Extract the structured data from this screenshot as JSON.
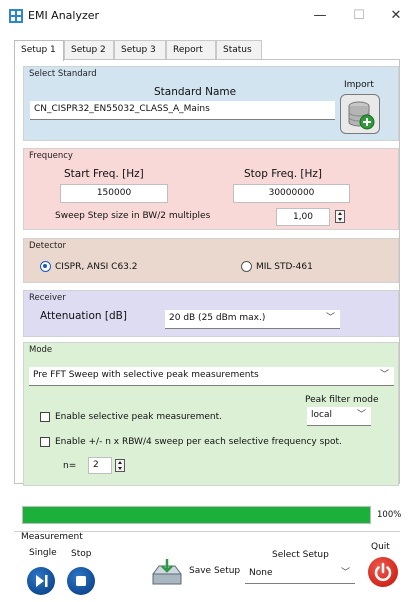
{
  "window": {
    "title": "EMI Analyzer",
    "minimize": "—",
    "maximize": "☐",
    "close": "✕"
  },
  "tabs": [
    {
      "label": "Setup 1",
      "active": true
    },
    {
      "label": "Setup 2",
      "active": false
    },
    {
      "label": "Setup 3",
      "active": false
    },
    {
      "label": "Report",
      "active": false
    },
    {
      "label": "Status",
      "active": false
    }
  ],
  "select_standard": {
    "group_title": "Select Standard",
    "column_label": "Standard Name",
    "standard_value": "CN_CISPR32_EN55032_CLASS_A_Mains",
    "import_label": "Import",
    "import_icon": "database-plus-icon"
  },
  "frequency": {
    "group_title": "Frequency",
    "start_label": "Start Freq. [Hz]",
    "start_value": "150000",
    "stop_label": "Stop Freq. [Hz]",
    "stop_value": "30000000",
    "sweep_label": "Sweep Step size in BW/2 multiples",
    "sweep_value": "1,00"
  },
  "detector": {
    "group_title": "Detector",
    "option_1": "CISPR, ANSI C63.2",
    "option_2": "MIL STD-461",
    "selected": "CISPR, ANSI C63.2"
  },
  "receiver": {
    "group_title": "Receiver",
    "attenuation_label": "Attenuation [dB]",
    "attenuation_value": "20 dB (25 dBm max.)"
  },
  "mode": {
    "group_title": "Mode",
    "mode_value": "Pre FFT Sweep with selective peak measurements",
    "peak_filter_label": "Peak filter mode",
    "peak_filter_value": "local",
    "enable_selective_label": "Enable selective peak measurement.",
    "enable_selective_checked": false,
    "enable_sweep_label": "Enable +/- n x RBW/4 sweep per each selective frequency spot.",
    "enable_sweep_checked": false,
    "n_label": "n=",
    "n_value": "2"
  },
  "progress": {
    "percent": 100,
    "text": "100%",
    "color": "#1ab03a"
  },
  "bottom": {
    "measurement_label": "Measurement",
    "single_label": "Single",
    "stop_label": "Stop",
    "save_label": "Save Setup",
    "select_setup_label": "Select Setup",
    "select_setup_value": "None",
    "quit_label": "Quit"
  }
}
